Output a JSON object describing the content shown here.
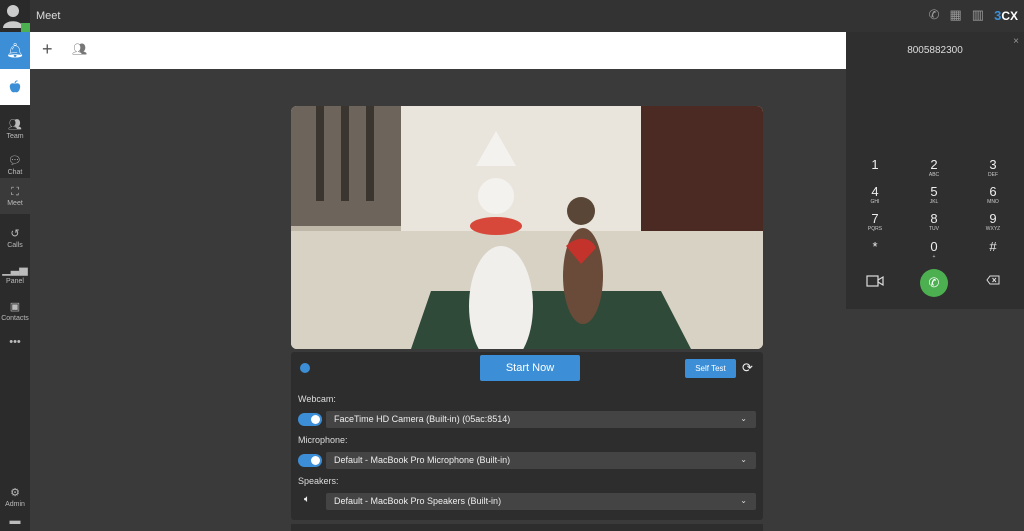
{
  "app": {
    "title": "Meet",
    "brand_prefix": "3",
    "brand_suffix": "CX"
  },
  "top_icons": [
    "phone-icon",
    "qr-code-icon",
    "book-icon"
  ],
  "sidebar": {
    "items": [
      {
        "label": "Team",
        "icon": "team-icon"
      },
      {
        "label": "Chat",
        "icon": "chat-icon"
      },
      {
        "label": "Meet",
        "icon": "meet-icon"
      },
      {
        "label": "Calls",
        "icon": "history-icon"
      },
      {
        "label": "Panel",
        "icon": "panel-icon"
      },
      {
        "label": "Contacts",
        "icon": "contacts-icon"
      }
    ],
    "more": "•••",
    "admin": "Admin"
  },
  "dialer": {
    "number": "8005882300",
    "keys": [
      {
        "d": "1",
        "l": ""
      },
      {
        "d": "2",
        "l": "ABC"
      },
      {
        "d": "3",
        "l": "DEF"
      },
      {
        "d": "4",
        "l": "GHI"
      },
      {
        "d": "5",
        "l": "JKL"
      },
      {
        "d": "6",
        "l": "MNO"
      },
      {
        "d": "7",
        "l": "PQRS"
      },
      {
        "d": "8",
        "l": "TUV"
      },
      {
        "d": "9",
        "l": "WXYZ"
      },
      {
        "d": "*",
        "l": ""
      },
      {
        "d": "0",
        "l": "+"
      },
      {
        "d": "#",
        "l": ""
      }
    ]
  },
  "meet": {
    "start_label": "Start Now",
    "self_test_label": "Self Test",
    "webcam_label": "Webcam:",
    "webcam_value": "FaceTime HD Camera (Built-in) (05ac:8514)",
    "microphone_label": "Microphone:",
    "microphone_value": "Default - MacBook Pro Microphone (Built-in)",
    "speakers_label": "Speakers:",
    "speakers_value": "Default - MacBook Pro Speakers (Built-in)"
  },
  "colors": {
    "accent": "#3c8fd6",
    "call_green": "#4caf50",
    "presence": "#4caf50"
  }
}
